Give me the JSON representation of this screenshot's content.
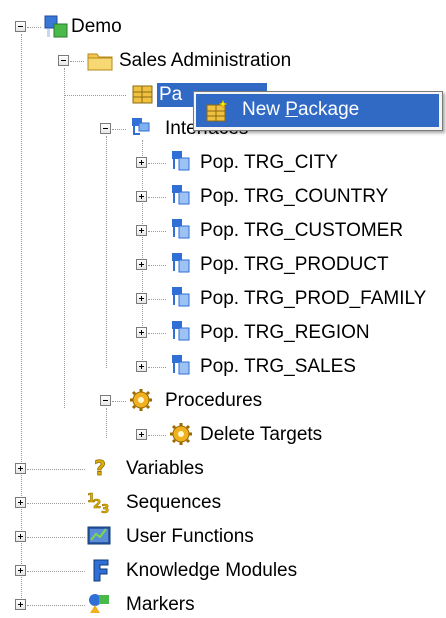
{
  "tree": {
    "demo": {
      "label": "Demo",
      "icon": "project-icon"
    },
    "sales_admin": {
      "label": "Sales Administration",
      "icon": "folder-icon"
    },
    "packages": {
      "label": "Packages",
      "visible_label": "Pa",
      "icon": "package-icon"
    },
    "interfaces": {
      "label": "Interfaces",
      "visible_label": "Interfaces",
      "icon": "interface-icon"
    },
    "interface_items": [
      {
        "label": "Pop. TRG_CITY",
        "icon": "interface-icon"
      },
      {
        "label": "Pop. TRG_COUNTRY",
        "icon": "interface-icon"
      },
      {
        "label": "Pop. TRG_CUSTOMER",
        "icon": "interface-icon"
      },
      {
        "label": "Pop. TRG_PRODUCT",
        "icon": "interface-icon"
      },
      {
        "label": "Pop. TRG_PROD_FAMILY",
        "icon": "interface-icon"
      },
      {
        "label": "Pop. TRG_REGION",
        "icon": "interface-icon"
      },
      {
        "label": "Pop. TRG_SALES",
        "icon": "interface-icon"
      }
    ],
    "procedures": {
      "label": "Procedures",
      "icon": "gear-icon"
    },
    "procedure_items": [
      {
        "label": "Delete Targets",
        "icon": "gear-icon"
      }
    ],
    "variables": {
      "label": "Variables",
      "icon": "question-icon"
    },
    "sequences": {
      "label": "Sequences",
      "icon": "sequence-icon"
    },
    "user_functions": {
      "label": "User Functions",
      "icon": "function-icon"
    },
    "knowledge_modules": {
      "label": "Knowledge Modules",
      "icon": "km-icon"
    },
    "markers": {
      "label": "Markers",
      "icon": "marker-icon"
    }
  },
  "context_menu": {
    "items": [
      {
        "label": "New Package",
        "mnemonic": "P",
        "icon": "new-package-icon"
      }
    ]
  },
  "colors": {
    "selection": "#316ac5",
    "tree_lines": "#9a9a9a",
    "folder": "#f3c54a",
    "interface_blue": "#2f6fd6"
  }
}
